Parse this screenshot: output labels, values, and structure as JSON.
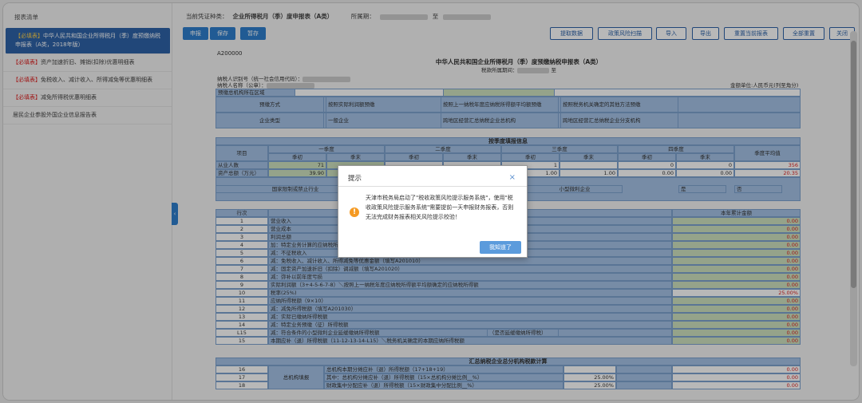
{
  "sidebar": {
    "title": "报表清单",
    "items": [
      {
        "tag": "【必填表】",
        "label": "中华人民共和国企业所得税月（季）度预缴纳税申报表（A类，2018年版）",
        "active": true
      },
      {
        "tag": "【必填表】",
        "label": "资产加速折旧、摊销(扣除)优惠明细表",
        "active": false
      },
      {
        "tag": "【必填表】",
        "label": "免税收入、减计收入、所得减免等优惠明细表",
        "active": false
      },
      {
        "tag": "【必填表】",
        "label": "减免所得税优惠明细表",
        "active": false
      },
      {
        "tag": "",
        "label": "居民企业参股外国企业信息报告表",
        "active": false
      }
    ],
    "toggle": "‹"
  },
  "topbar": {
    "voucher_label": "当前凭证种类：",
    "voucher_value": "企业所得税月（季）度申报表（A类）",
    "period_label": "所属期：",
    "period_value": "至"
  },
  "toolbar": {
    "left": [
      "申报",
      "保存",
      "暂存"
    ],
    "right": [
      "提取数据",
      "政策风险扫描",
      "导入",
      "导出",
      "重置当前报表",
      "全部重置",
      "关闭"
    ]
  },
  "form": {
    "code": "A200000",
    "title": "中华人民共和国企业所得税月（季）度预缴纳税申报表（A类）",
    "period": "税款所属期间：",
    "to": "至",
    "taxpayer_id": "纳税人识别号（统一社会信用代码）：",
    "taxpayer_name": "纳税人名称（公章）：",
    "unit": "金额单位:人民币元(列至角分)",
    "region": "预缴总机构所在区域"
  },
  "method": {
    "label": "预缴方式",
    "opts": [
      "按照实际利润额预缴",
      "按照上一纳税年度应纳税所得额平均额预缴",
      "按照税务机关确定的其他方法预缴"
    ]
  },
  "ent": {
    "label": "企业类型",
    "opts": [
      "一般企业",
      "跨地区经营汇总纳税企业总机构",
      "跨地区经营汇总纳税企业分支机构"
    ]
  },
  "quarter": {
    "title": "按季度填报信息",
    "item": "项目",
    "q": [
      "一季度",
      "二季度",
      "三季度",
      "四季度"
    ],
    "begin": "季初",
    "end": "季末",
    "avg": "季度平均值",
    "rows": [
      {
        "label": "从业人数",
        "v": [
          "71",
          "",
          "",
          "",
          "1",
          "",
          "0",
          "0"
        ],
        "avg": "356"
      },
      {
        "label": "资产总额（万元）",
        "v": [
          "39.90",
          "",
          "",
          "",
          "1.00",
          "1.00",
          "0.00",
          "0.00"
        ],
        "avg": "20.35"
      }
    ],
    "restricted": "国家限制或禁止行业",
    "small": "小型微利企业",
    "yes": "是",
    "no": "否"
  },
  "main": {
    "seq": "行次",
    "amount": "本年累计金额",
    "rows": [
      {
        "n": "1",
        "t": "营业收入",
        "v": "0.00"
      },
      {
        "n": "2",
        "t": "营业成本",
        "v": "0.00"
      },
      {
        "n": "3",
        "t": "利润总额",
        "v": "0.00"
      },
      {
        "n": "4",
        "t": "加：特定业务计算的应纳税所得额",
        "v": "0.00"
      },
      {
        "n": "5",
        "t": "减：不征税收入",
        "v": "0.00"
      },
      {
        "n": "6",
        "t": "减：免税收入、减计收入、所得减免等优惠金额（填写A201010）",
        "v": "0.00"
      },
      {
        "n": "7",
        "t": "减：固定资产加速折旧（扣除）调减额（填写A201020）",
        "v": "0.00"
      },
      {
        "n": "8",
        "t": "减：弥补以前年度亏损",
        "v": "0.00"
      },
      {
        "n": "9",
        "t": "实际利润额（3+4-5-6-7-8）＼按照上一纳税年度应纳税所得额平均额确定的应纳税所得额",
        "v": "0.00"
      },
      {
        "n": "10",
        "t": "税率(25%)",
        "v": "25.00%"
      },
      {
        "n": "11",
        "t": "应纳所得税额（9×10）",
        "v": "0.00"
      },
      {
        "n": "12",
        "t": "减：减免所得税额（填写A201030）",
        "v": "0.00"
      },
      {
        "n": "13",
        "t": "减：实际已缴纳所得税额",
        "v": "0.00"
      },
      {
        "n": "14",
        "t": "减：特定业务预缴（征）所得税额",
        "v": "0.00"
      },
      {
        "n": "L15",
        "t": "减：符合条件的小型微利企业延缓缴纳所得税额",
        "v": "0.00",
        "extra": "（是否延缓缴纳所得税）"
      },
      {
        "n": "15",
        "t": "本期应补（退）所得税额（11-12-13-14-L15）＼税务机关确定的本期应纳所得税额",
        "v": "0.00"
      }
    ]
  },
  "branch": {
    "title": "汇总纳税企业总分机构税款计算",
    "label": "总机构填报",
    "rows": [
      {
        "n": "16",
        "t": "总机构本期分摊应补（退）所得税额（17+18+19）",
        "pct": "",
        "v": "0.00"
      },
      {
        "n": "17",
        "t": "其中：总机构分摊应补（退）所得税额（15×总机构分摊比例__%）",
        "pct": "25.00%",
        "v": "0.00"
      },
      {
        "n": "18",
        "t": "财政集中分配应补（退）所得税额（15×财政集中分配比例__%）",
        "pct": "25.00%",
        "v": "0.00"
      }
    ]
  },
  "dialog": {
    "title": "提示",
    "close": "×",
    "icon": "!",
    "msg": "天津市税务局启动了\"税收政策风险提示服务系统\"，使用\"税收政策风险提示服务系统\"需要提前一天申报财务报表，否则无法完成财务报表相关风险提示校验！",
    "btn": "我知道了"
  }
}
